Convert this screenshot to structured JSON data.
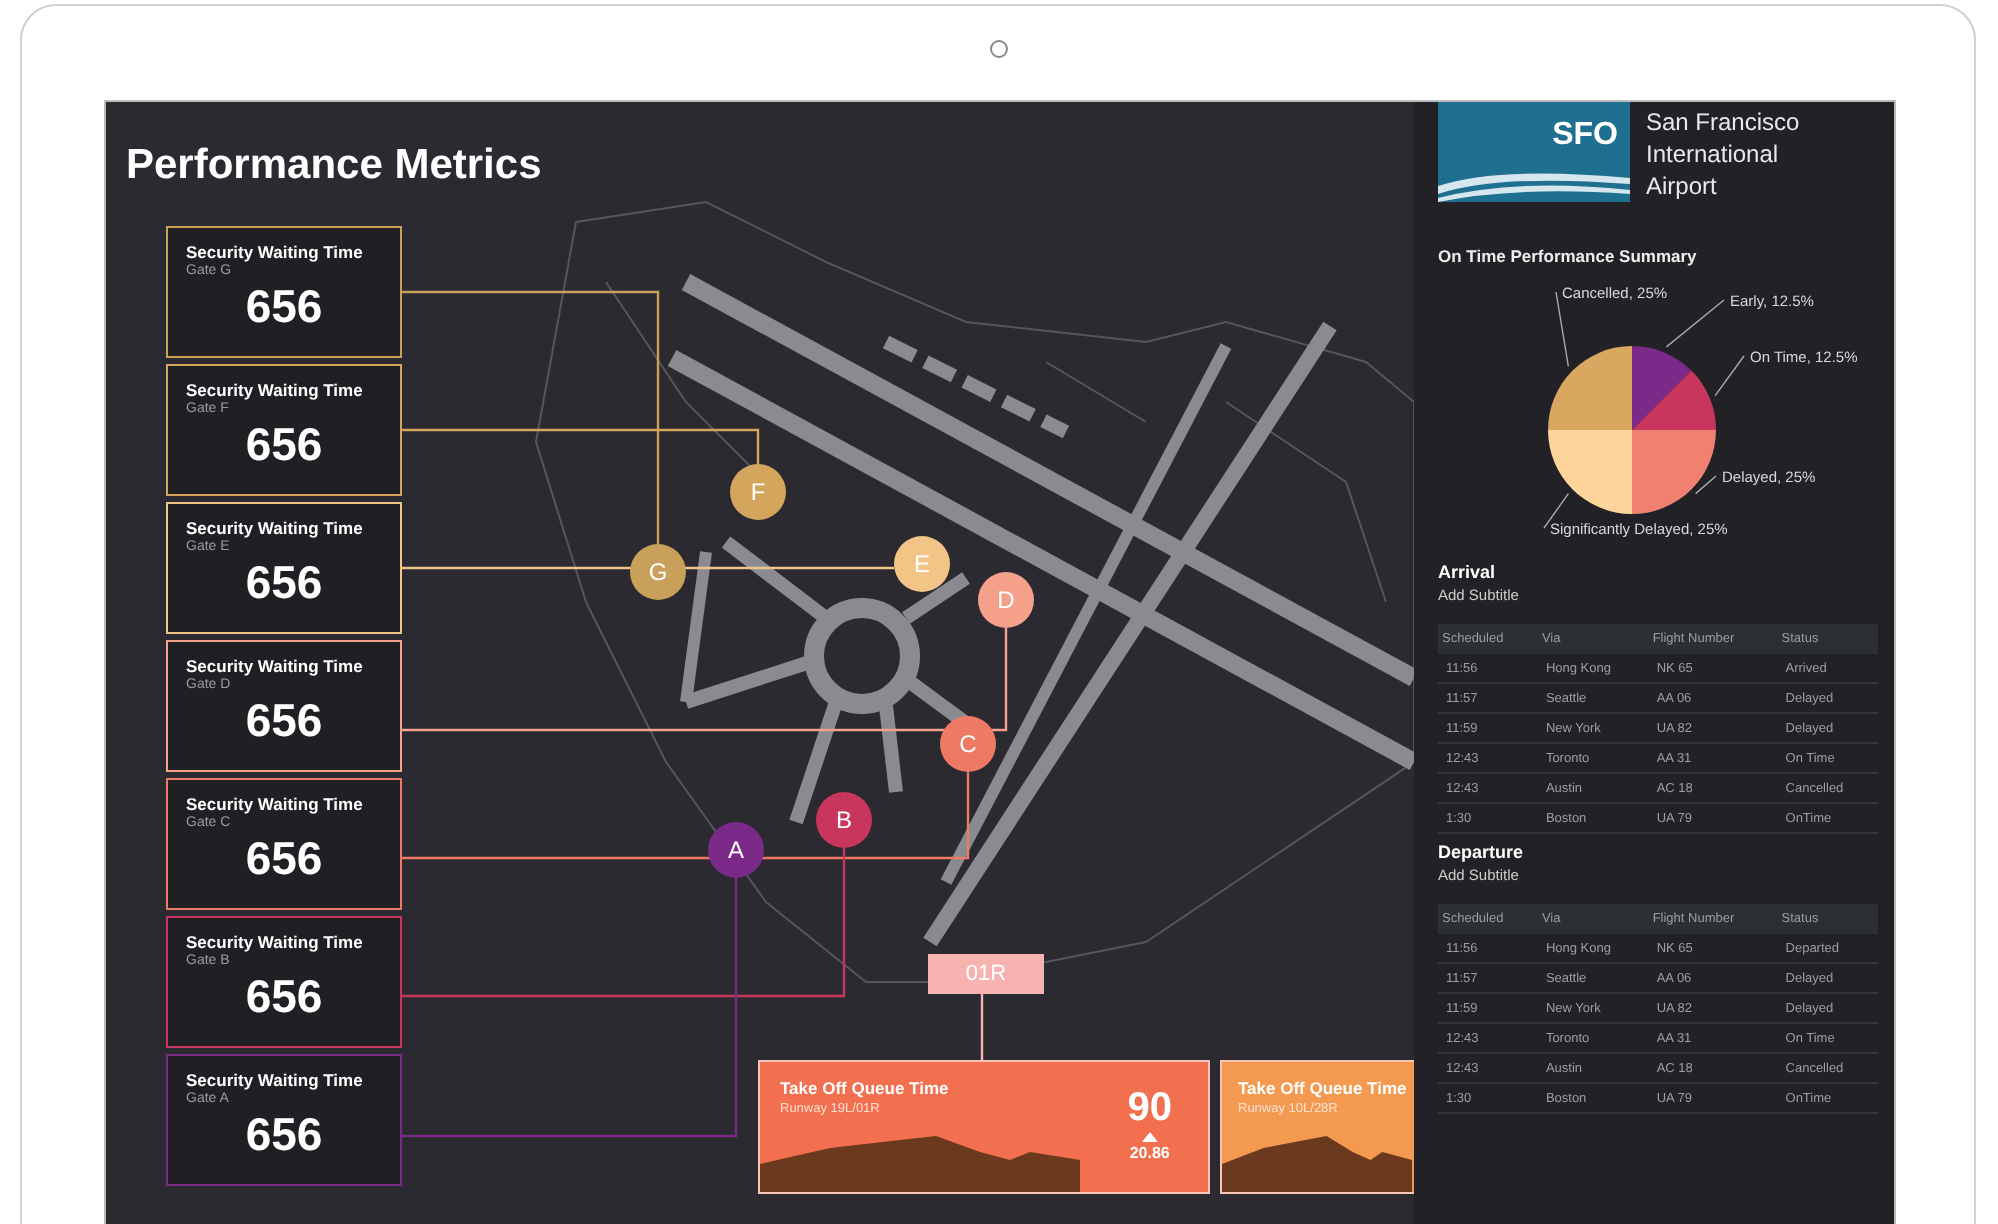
{
  "title": "Performance Metrics",
  "gates": [
    {
      "label": "G",
      "color": "#c9a05a",
      "card_title": "Security Waiting Time",
      "card_subtitle": "Gate G",
      "value": "656"
    },
    {
      "label": "F",
      "color": "#d4a55c",
      "card_title": "Security Waiting Time",
      "card_subtitle": "Gate F",
      "value": "656"
    },
    {
      "label": "E",
      "color": "#f2c486",
      "card_title": "Security Waiting Time",
      "card_subtitle": "Gate E",
      "value": "656"
    },
    {
      "label": "D",
      "color": "#f4a08a",
      "card_title": "Security Waiting Time",
      "card_subtitle": "Gate D",
      "value": "656"
    },
    {
      "label": "C",
      "color": "#ee7a66",
      "card_title": "Security Waiting Time",
      "card_subtitle": "Gate C",
      "value": "656"
    },
    {
      "label": "B",
      "color": "#c8365e",
      "card_title": "Security Waiting Time",
      "card_subtitle": "Gate B",
      "value": "656"
    },
    {
      "label": "A",
      "color": "#7b2a8a",
      "card_title": "Security Waiting Time",
      "card_subtitle": "Gate A",
      "value": "656"
    }
  ],
  "runway_label": "01R",
  "takeoff_cards": [
    {
      "title": "Take Off Queue Time",
      "subtitle": "Runway 19L/01R",
      "value": "90",
      "change": "20.86",
      "color": "#f26f50"
    },
    {
      "title": "Take Off Queue Time",
      "subtitle": "Runway 10L/28R",
      "color": "#f39a50"
    }
  ],
  "airport": {
    "code": "SFO",
    "name_lines": [
      "San Francisco",
      "International",
      "Airport"
    ]
  },
  "summary": {
    "chart_data": {
      "type": "pie",
      "title": "On Time Performance Summary",
      "categories": [
        "Early",
        "On Time",
        "Delayed",
        "Significantly Delayed",
        "Cancelled"
      ],
      "values": [
        12.5,
        12.5,
        25,
        25,
        25
      ],
      "colors": [
        "#7b2a8a",
        "#c8365e",
        "#f08070",
        "#fdd59b",
        "#d9a860"
      ],
      "value_labels": [
        "12.5%",
        "12.5%",
        "25%",
        "25%",
        "25%"
      ]
    }
  },
  "arrival": {
    "title": "Arrival",
    "subtitle": "Add Subtitle",
    "columns": [
      "Scheduled",
      "Via",
      "Flight Number",
      "Status"
    ],
    "rows": [
      [
        "11:56",
        "Hong Kong",
        "NK 65",
        "Arrived"
      ],
      [
        "11:57",
        "Seattle",
        "AA 06",
        "Delayed"
      ],
      [
        "11:59",
        "New York",
        "UA 82",
        "Delayed"
      ],
      [
        "12:43",
        "Toronto",
        "AA 31",
        "On Time"
      ],
      [
        "12:43",
        "Austin",
        "AC 18",
        "Cancelled"
      ],
      [
        "1:30",
        "Boston",
        "UA 79",
        "OnTime"
      ]
    ]
  },
  "departure": {
    "title": "Departure",
    "subtitle": "Add Subtitle",
    "columns": [
      "Scheduled",
      "Via",
      "Flight Number",
      "Status"
    ],
    "rows": [
      [
        "11:56",
        "Hong Kong",
        "NK 65",
        "Departed"
      ],
      [
        "11:57",
        "Seattle",
        "AA 06",
        "Delayed"
      ],
      [
        "11:59",
        "New York",
        "UA 82",
        "Delayed"
      ],
      [
        "12:43",
        "Toronto",
        "AA 31",
        "On Time"
      ],
      [
        "12:43",
        "Austin",
        "AC 18",
        "Cancelled"
      ],
      [
        "1:30",
        "Boston",
        "UA 79",
        "OnTime"
      ]
    ]
  }
}
